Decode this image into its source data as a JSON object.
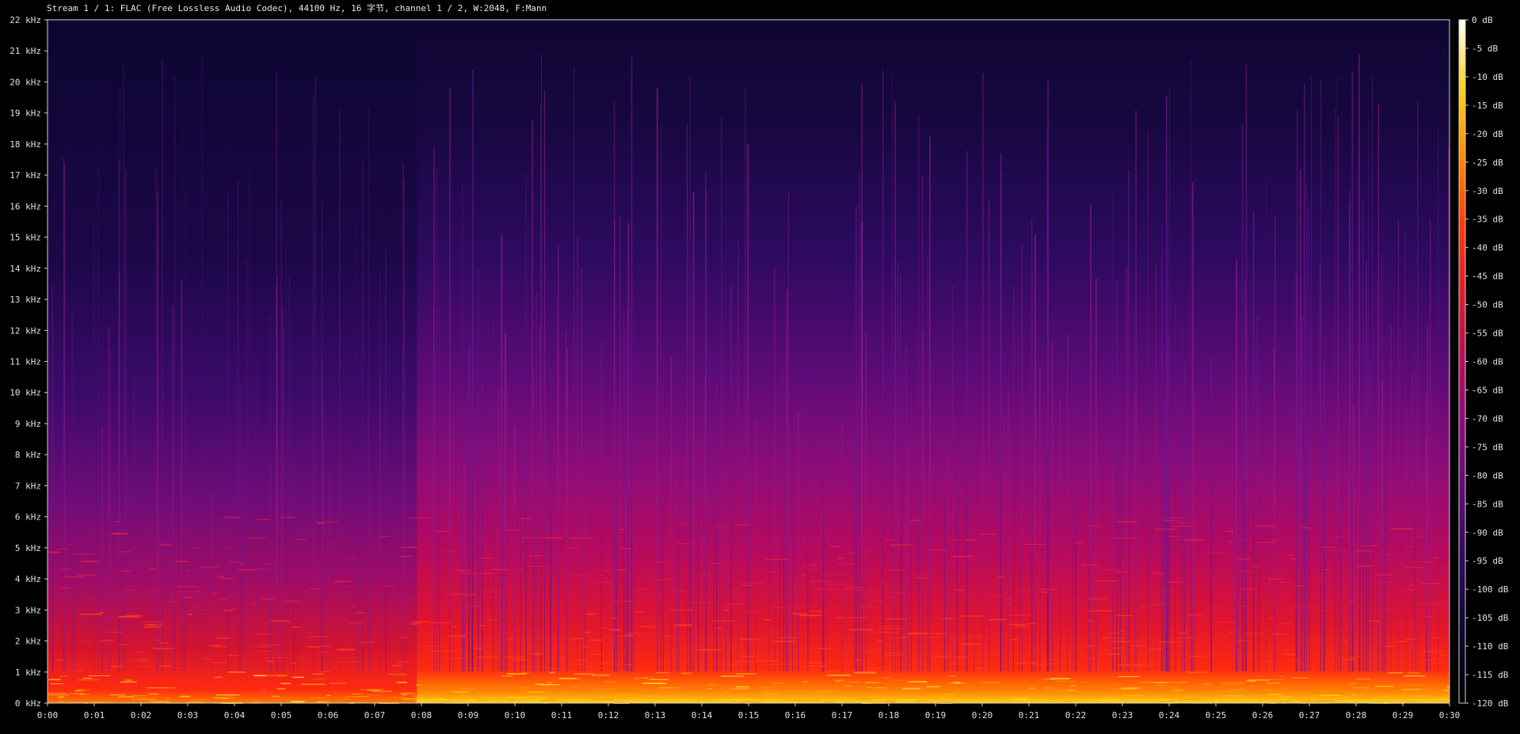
{
  "header": {
    "title": "Stream 1 / 1: FLAC (Free Lossless Audio Codec), 44100 Hz, 16 字节, channel 1 / 2, W:2048, F:Mann"
  },
  "chart_data": {
    "type": "heatmap",
    "x_unit": "time",
    "x_ticks": [
      "0:00",
      "0:01",
      "0:02",
      "0:03",
      "0:04",
      "0:05",
      "0:06",
      "0:07",
      "0:08",
      "0:09",
      "0:10",
      "0:11",
      "0:12",
      "0:13",
      "0:14",
      "0:15",
      "0:16",
      "0:17",
      "0:18",
      "0:19",
      "0:20",
      "0:21",
      "0:22",
      "0:23",
      "0:24",
      "0:25",
      "0:26",
      "0:27",
      "0:28",
      "0:29",
      "0:30"
    ],
    "xlim": [
      0,
      30
    ],
    "y_ticks": [
      "0 kHz",
      "1 kHz",
      "2 kHz",
      "3 kHz",
      "4 kHz",
      "5 kHz",
      "6 kHz",
      "7 kHz",
      "8 kHz",
      "9 kHz",
      "10 kHz",
      "11 kHz",
      "12 kHz",
      "13 kHz",
      "14 kHz",
      "15 kHz",
      "16 kHz",
      "17 kHz",
      "18 kHz",
      "19 kHz",
      "20 kHz",
      "21 kHz",
      "22 kHz"
    ],
    "ylim": [
      0,
      22
    ],
    "colorbar_ticks": [
      "0 dB",
      "-5 dB",
      "-10 dB",
      "-15 dB",
      "-20 dB",
      "-25 dB",
      "-30 dB",
      "-35 dB",
      "-40 dB",
      "-45 dB",
      "-50 dB",
      "-55 dB",
      "-60 dB",
      "-65 dB",
      "-70 dB",
      "-75 dB",
      "-80 dB",
      "-85 dB",
      "-90 dB",
      "-95 dB",
      "-100 dB",
      "-105 dB",
      "-110 dB",
      "-115 dB",
      "-120 dB"
    ],
    "zlim": [
      -120,
      0
    ],
    "colormap": [
      "#000000",
      "#0d0730",
      "#2a0a5c",
      "#5c0b78",
      "#8a0a7c",
      "#b80a5c",
      "#e01c2c",
      "#ff3a0a",
      "#ff8a00",
      "#ffd21a",
      "#ffffff"
    ],
    "section_change_time": 7.9
  }
}
